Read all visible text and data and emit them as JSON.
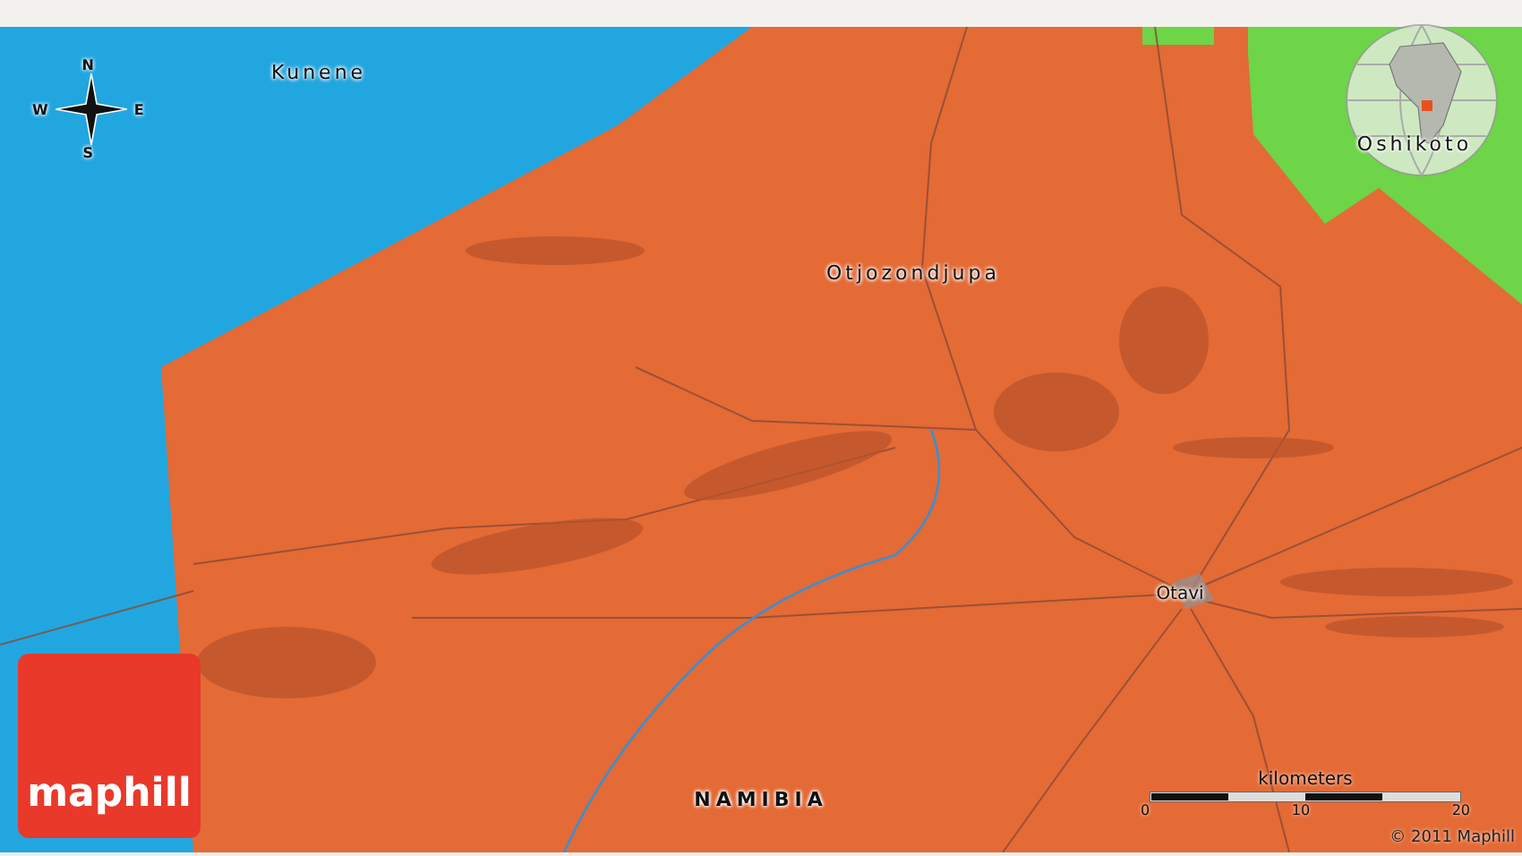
{
  "map": {
    "labels": [
      {
        "kind": "region",
        "text": "Kunene"
      },
      {
        "kind": "region",
        "text": "Otjozondjupa"
      },
      {
        "kind": "region",
        "text": "Oshikoto"
      },
      {
        "kind": "town",
        "text": "Otavi"
      },
      {
        "kind": "country",
        "text": "NAMIBIA"
      }
    ],
    "compass": {
      "north": "N",
      "south": "S",
      "east": "E",
      "west": "W"
    },
    "scale": {
      "title": "kilometers",
      "ticks": [
        "0",
        "10",
        "20"
      ]
    },
    "copyright": "© 2011 Maphill",
    "logo": "maphill"
  }
}
